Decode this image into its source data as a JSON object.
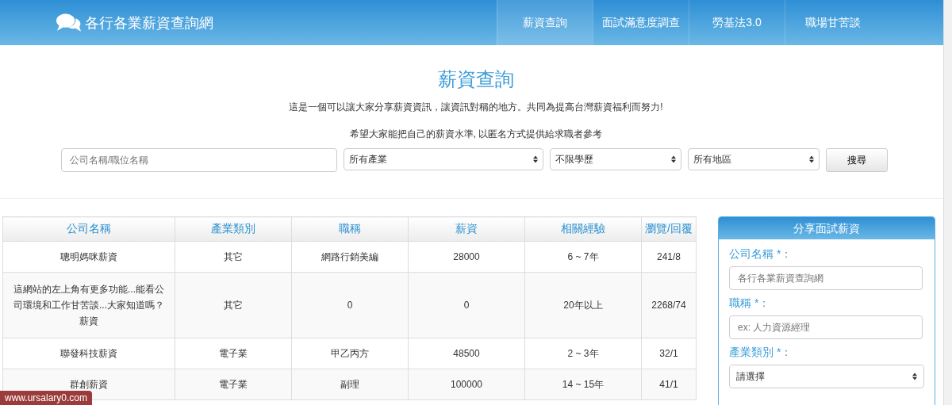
{
  "header": {
    "logo_text": "各行各業薪資查詢網",
    "nav": [
      {
        "label": "薪資查詢",
        "selected": true
      },
      {
        "label": "面試滿意度調查",
        "selected": false
      },
      {
        "label": "勞基法3.0",
        "selected": false
      },
      {
        "label": "職場甘苦談",
        "selected": false
      }
    ]
  },
  "intro": {
    "title": "薪資查詢",
    "lines": [
      "這是一個可以讓大家分享薪資資訊，讓資訊對稱的地方。共同為提高台灣薪資福利而努力!",
      "希望大家能把自己的薪資水準, 以匿名方式提供給求職者參考"
    ]
  },
  "search": {
    "placeholder": "公司名稱/職位名稱",
    "selects": [
      "所有產業",
      "不限學歷",
      "所有地區"
    ],
    "button": "搜尋"
  },
  "table": {
    "columns": [
      "公司名稱",
      "產業類別",
      "職稱",
      "薪資",
      "相關經驗",
      "瀏覽/回覆"
    ],
    "rows": [
      [
        "聰明媽咪薪資",
        "其它",
        "網路行銷美編",
        "28000",
        "6 ~ 7年",
        "241/8"
      ],
      [
        "這網站的左上角有更多功能...能看公司環境和工作甘苦談...大家知道嗎？薪資",
        "其它",
        "0",
        "0",
        "20年以上",
        "2268/74"
      ],
      [
        "聯發科技薪資",
        "電子業",
        "甲乙丙方",
        "48500",
        "2 ~ 3年",
        "32/1"
      ],
      [
        "群創薪資",
        "電子業",
        "副理",
        "100000",
        "14 ~ 15年",
        "41/1"
      ]
    ]
  },
  "share_panel": {
    "title": "分享面試薪資",
    "fields": [
      {
        "kind": "input",
        "label": "公司名稱 *：",
        "placeholder": "各行各業薪資查詢網"
      },
      {
        "kind": "input",
        "label": "職稱 *：",
        "placeholder": "ex: 人力資源經理"
      },
      {
        "kind": "select",
        "label": "產業類別 *：",
        "value": "請選擇"
      }
    ]
  },
  "status_url": "www.ursalary0.com"
}
